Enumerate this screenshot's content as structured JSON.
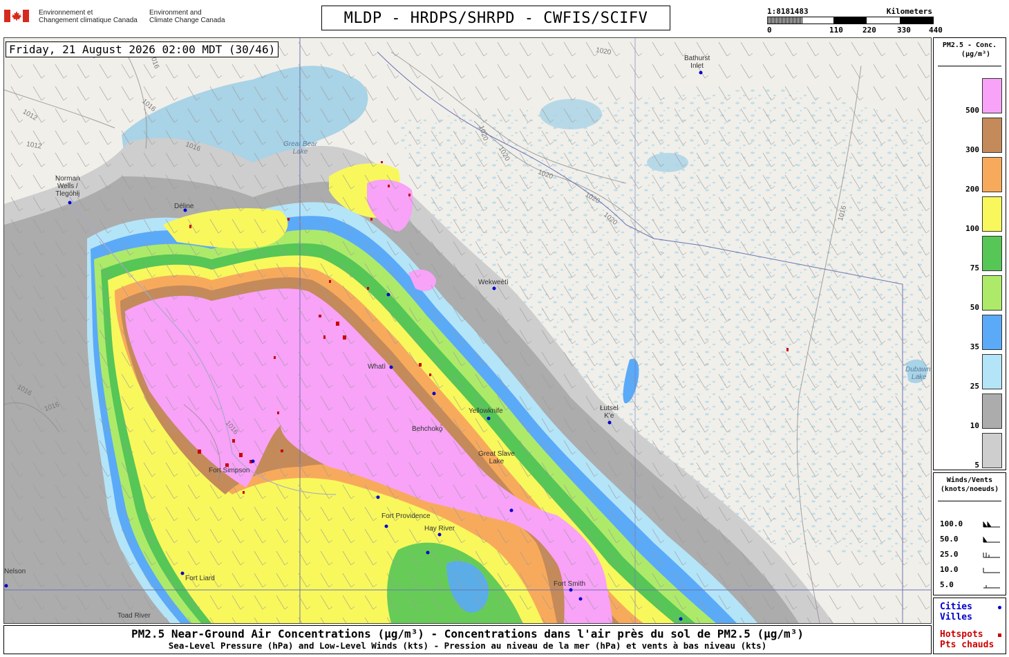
{
  "header": {
    "gov_fr": [
      "Environnement et",
      "Changement climatique Canada"
    ],
    "gov_en": [
      "Environment and",
      "Climate Change Canada"
    ],
    "title": "MLDP - HRDPS/SHRPD - CWFIS/SCIFV",
    "scale_ratio": "1:8181483",
    "scale_unit": "Kilometers",
    "scale_ticks": [
      "0",
      "110",
      "220",
      "330",
      "440"
    ]
  },
  "map": {
    "timestamp": "Friday, 21 August 2026 02:00 MDT (30/46)",
    "places": [
      "Norman",
      "Wells /",
      "Tlegóhłį",
      "Déline",
      "Bathurst",
      "Inlet",
      "Wekweètì",
      "Whatì",
      "Yellowknife",
      "Great Slave",
      "Lake",
      "Łutsel",
      "K'e",
      "Hay River",
      "Fort Smith",
      "Fort Liard",
      "Toad River",
      "Nelson",
      "Fort Simpson",
      "Fort Providence",
      "Behchokǫ̀"
    ],
    "lakes": [
      "Great Bear",
      "Lake",
      "Dubawnt",
      "Lake"
    ],
    "isobars": [
      "1012",
      "1012",
      "1016",
      "1016",
      "1016",
      "1016",
      "1016",
      "1016",
      "1016",
      "1020",
      "1020",
      "1020",
      "1020",
      "1020",
      "1020"
    ],
    "colors": {
      "land": "#f1efea",
      "water": "#a9d3e6",
      "c5": "#cecece",
      "c10": "#acacac",
      "c25": "#b4e4f8",
      "c35": "#5aaaf8",
      "c50": "#aeea6a",
      "c75": "#56c656",
      "c100": "#f8f85c",
      "c200": "#f8aa5c",
      "c300": "#c48a5a",
      "c500": "#f8a2f8",
      "hotspot": "#cc0000",
      "city": "#0000cc"
    }
  },
  "legend": {
    "title_line1": "PM2.5 - Conc.",
    "title_line2": "(µg/m³)",
    "levels": [
      {
        "label": "500",
        "color": "#f8a2f8"
      },
      {
        "label": "300",
        "color": "#c48a5a"
      },
      {
        "label": "200",
        "color": "#f8aa5c"
      },
      {
        "label": "100",
        "color": "#f8f85c"
      },
      {
        "label": "75",
        "color": "#56c656"
      },
      {
        "label": "50",
        "color": "#aeea6a"
      },
      {
        "label": "35",
        "color": "#5aaaf8"
      },
      {
        "label": "25",
        "color": "#b4e4f8"
      },
      {
        "label": "10",
        "color": "#acacac"
      },
      {
        "label": "5",
        "color": "#cecece"
      }
    ]
  },
  "winds": {
    "title_line1": "Winds/Vents",
    "title_line2": "(knots/noeuds)",
    "rows": [
      "100.0",
      "50.0",
      "25.0",
      "10.0",
      "5.0"
    ]
  },
  "cities_box": {
    "cities": "Cities",
    "villes": "Villes",
    "hotspots": "Hotspots",
    "pts_chauds": "Pts chauds"
  },
  "caption": {
    "line1": "PM2.5 Near-Ground Air Concentrations (µg/m³) - Concentrations dans l'air près du sol de PM2.5 (µg/m³)",
    "line2": "Sea-Level Pressure (hPa) and Low-Level Winds (kts) - Pression au niveau de la mer (hPa) et vents à bas niveau (kts)"
  }
}
